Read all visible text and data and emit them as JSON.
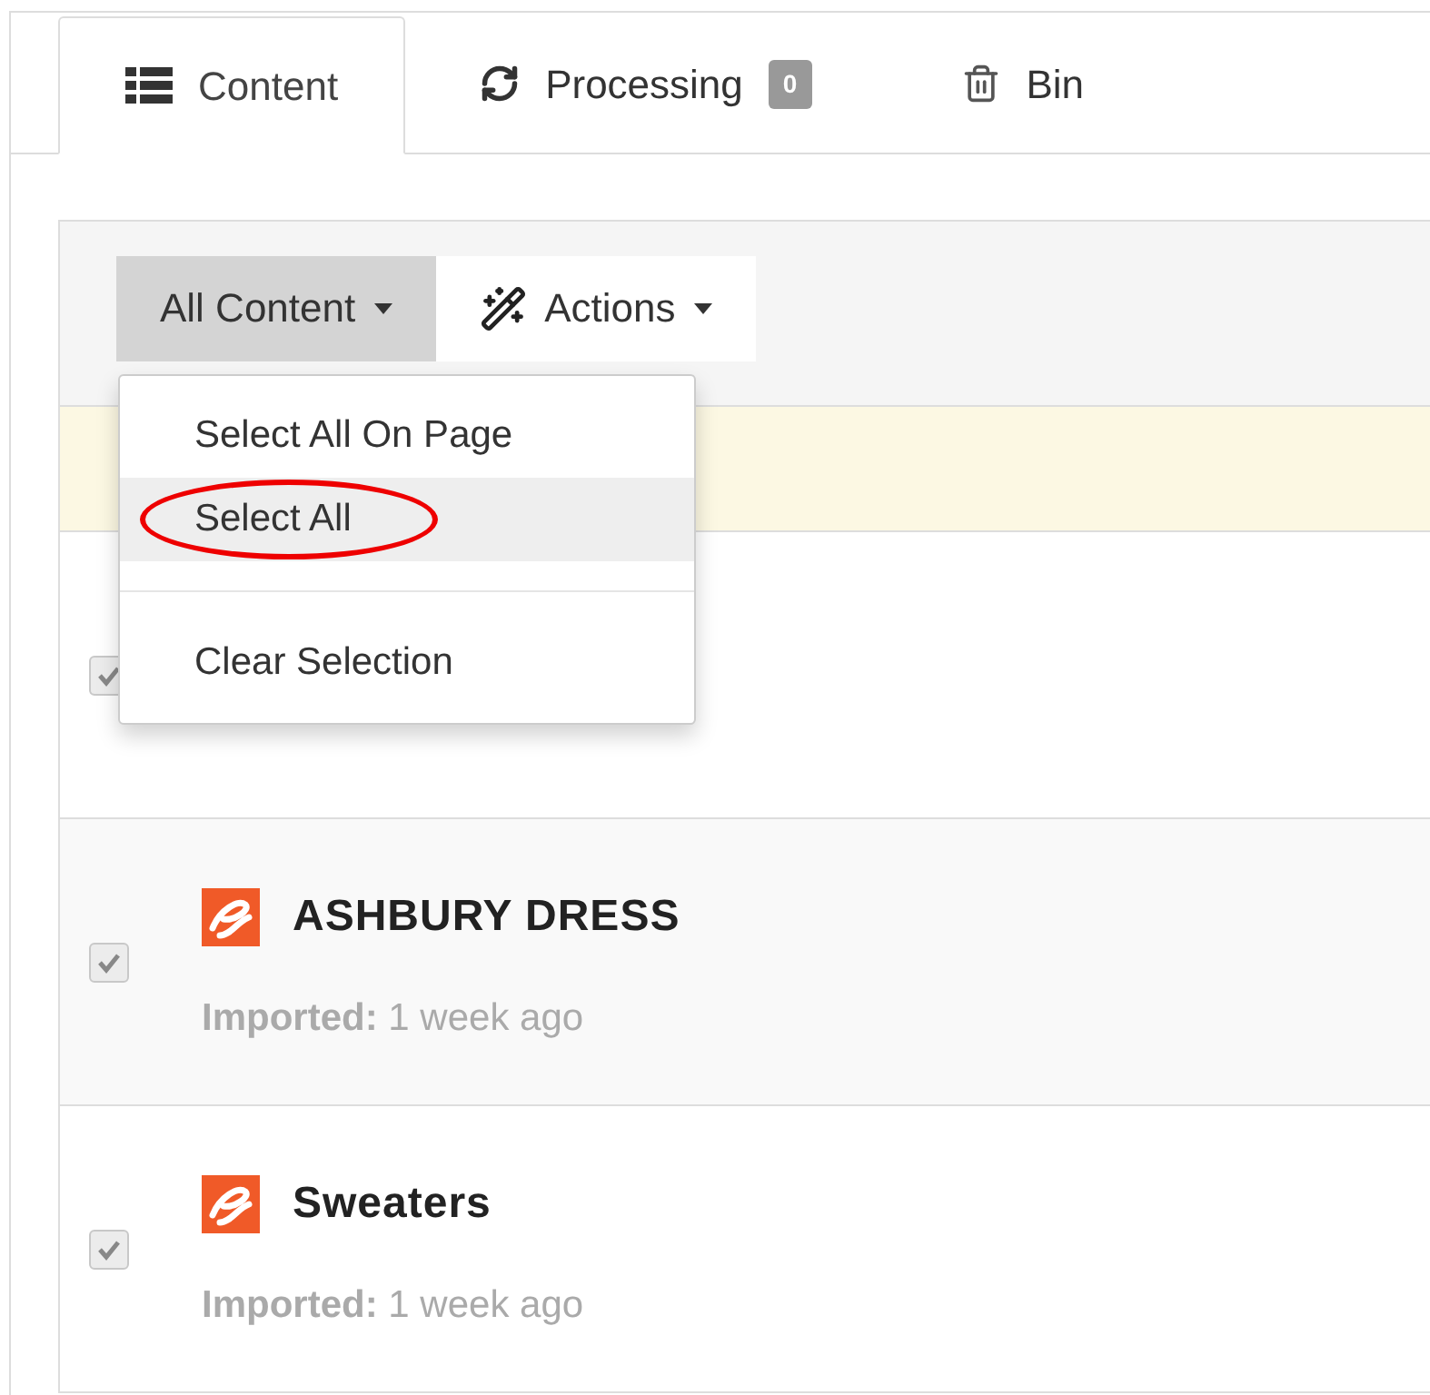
{
  "tabs": [
    {
      "label": "Content",
      "selected": true
    },
    {
      "label": "Processing",
      "badge": "0",
      "selected": false
    },
    {
      "label": "Bin",
      "selected": false
    }
  ],
  "toolbar": {
    "buttons": [
      {
        "label": "All Content",
        "open": true
      },
      {
        "label": "Actions",
        "open": false
      }
    ]
  },
  "dropdown": {
    "items": [
      {
        "kind": "item",
        "label": "Select All On Page",
        "highlighted": false,
        "circled": false
      },
      {
        "kind": "item",
        "label": "Select All",
        "highlighted": true,
        "circled": true
      },
      {
        "kind": "divider"
      },
      {
        "kind": "item",
        "label": "Clear Selection",
        "highlighted": false,
        "circled": false
      }
    ]
  },
  "rows": [
    {
      "checked": true
    },
    {
      "checked": true,
      "title": "ASHBURY DRESS",
      "meta_label": "Imported:",
      "meta_value": "1 week ago"
    },
    {
      "checked": true,
      "title": "Sweaters",
      "meta_label": "Imported:",
      "meta_value": "1 week ago"
    }
  ]
}
